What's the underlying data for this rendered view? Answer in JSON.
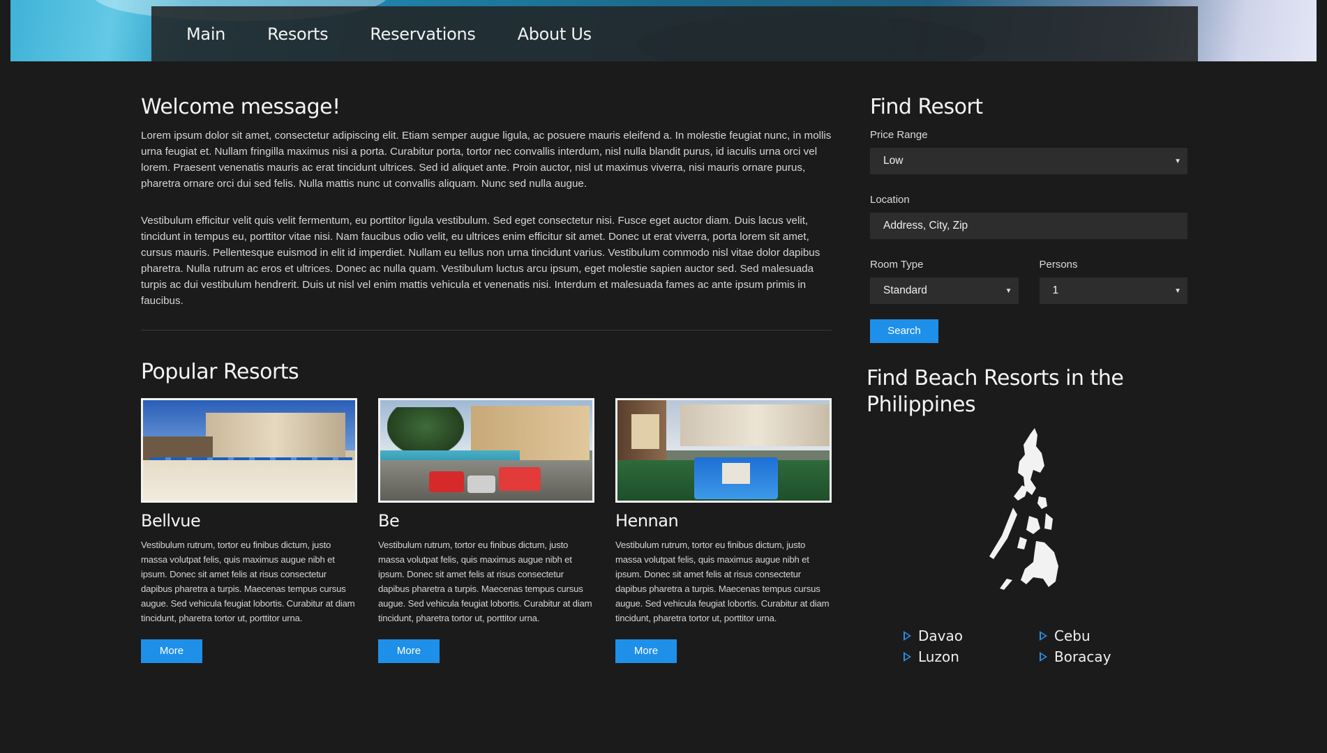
{
  "nav": {
    "items": [
      "Main",
      "Resorts",
      "Reservations",
      "About Us"
    ]
  },
  "welcome": {
    "title": "Welcome message!",
    "p1": "Lorem ipsum dolor sit amet, consectetur adipiscing elit. Etiam semper augue ligula, ac posuere mauris eleifend a. In molestie feugiat nunc, in mollis urna feugiat et. Nullam fringilla maximus nisi a porta. Curabitur porta, tortor nec convallis interdum, nisl nulla blandit purus, id iaculis urna orci vel lorem. Praesent venenatis mauris ac erat tincidunt ultrices. Sed id aliquet ante. Proin auctor, nisl ut maximus viverra, nisi mauris ornare purus, pharetra ornare orci dui sed felis. Nulla mattis nunc ut convallis aliquam. Nunc sed nulla augue.",
    "p2": "Vestibulum efficitur velit quis velit fermentum, eu porttitor ligula vestibulum. Sed eget consectetur nisi. Fusce eget auctor diam. Duis lacus velit, tincidunt in tempus eu, porttitor vitae nisi. Nam faucibus odio velit, eu ultrices enim efficitur sit amet. Donec ut erat viverra, porta lorem sit amet, cursus mauris. Pellentesque euismod in elit id imperdiet. Nullam eu tellus non urna tincidunt varius. Vestibulum commodo nisl vitae dolor dapibus pharetra. Nulla rutrum ac eros et ultrices. Donec ac nulla quam. Vestibulum luctus arcu ipsum, eget molestie sapien auctor sed. Sed malesuada turpis ac dui vestibulum hendrerit. Duis ut nisl vel enim mattis vehicula et venenatis nisi. Interdum et malesuada fames ac ante ipsum primis in faucibus."
  },
  "popular": {
    "title": "Popular Resorts",
    "cards": [
      {
        "name": "Bellvue",
        "text": "Vestibulum rutrum, tortor eu finibus dictum, justo massa volutpat felis, quis maximus augue nibh et ipsum. Donec sit amet felis at risus consectetur dapibus pharetra a turpis. Maecenas tempus cursus augue. Sed vehicula feugiat lobortis. Curabitur at diam tincidunt, pharetra tortor ut, porttitor urna.",
        "button": "More"
      },
      {
        "name": "Be",
        "text": "Vestibulum rutrum, tortor eu finibus dictum, justo massa volutpat felis, quis maximus augue nibh et ipsum. Donec sit amet felis at risus consectetur dapibus pharetra a turpis. Maecenas tempus cursus augue. Sed vehicula feugiat lobortis. Curabitur at diam tincidunt, pharetra tortor ut, porttitor urna.",
        "button": "More"
      },
      {
        "name": "Hennan",
        "text": "Vestibulum rutrum, tortor eu finibus dictum, justo massa volutpat felis, quis maximus augue nibh et ipsum. Donec sit amet felis at risus consectetur dapibus pharetra a turpis. Maecenas tempus cursus augue. Sed vehicula feugiat lobortis. Curabitur at diam tincidunt, pharetra tortor ut, porttitor urna.",
        "button": "More"
      }
    ]
  },
  "find": {
    "title": "Find Resort",
    "price_label": "Price Range",
    "price_value": "Low",
    "location_label": "Location",
    "location_placeholder": "Address, City, Zip",
    "room_label": "Room Type",
    "room_value": "Standard",
    "persons_label": "Persons",
    "persons_value": "1",
    "search_button": "Search"
  },
  "beach": {
    "title": "Find Beach Resorts in the Philippines",
    "cities": [
      "Davao",
      "Cebu",
      "Luzon",
      "Boracay"
    ]
  },
  "colors": {
    "accent": "#1e90ea",
    "background": "#1b1b1b",
    "field": "#2d2d2d"
  }
}
